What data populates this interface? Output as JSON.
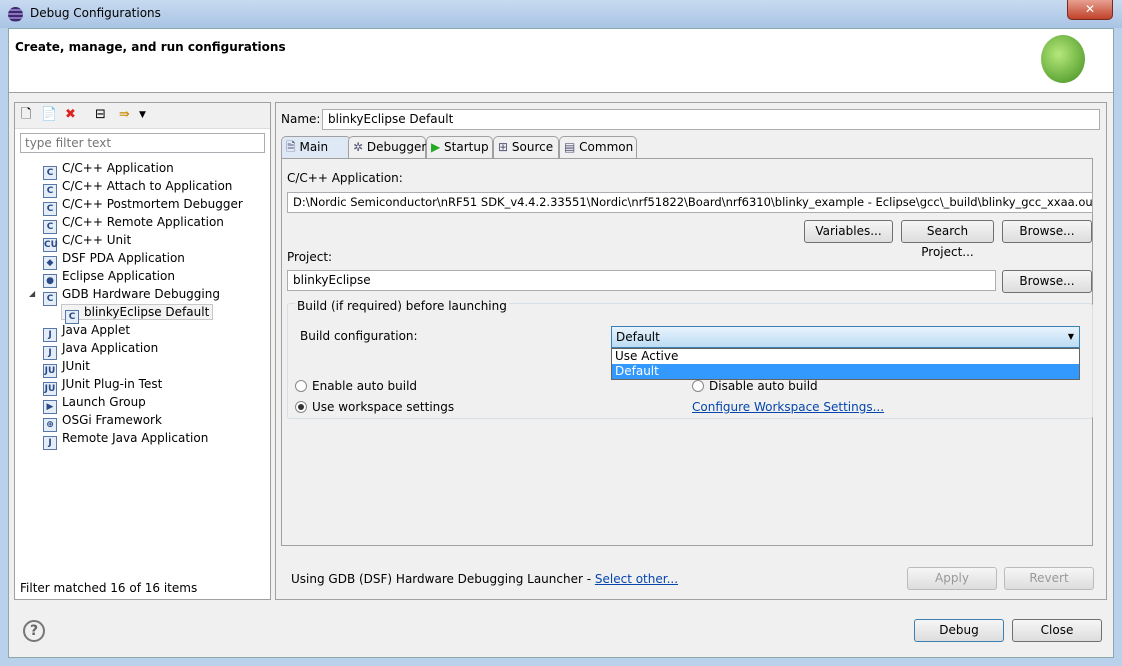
{
  "window": {
    "title": "Debug Configurations",
    "close": "✕"
  },
  "header": {
    "title": "Create, manage, and run configurations"
  },
  "left": {
    "filter_placeholder": "type filter text",
    "items": [
      {
        "label": "C/C++ Application",
        "icon": "C"
      },
      {
        "label": "C/C++ Attach to Application",
        "icon": "C"
      },
      {
        "label": "C/C++ Postmortem Debugger",
        "icon": "C"
      },
      {
        "label": "C/C++ Remote Application",
        "icon": "C"
      },
      {
        "label": "C/C++ Unit",
        "icon": "CU"
      },
      {
        "label": "DSF PDA Application",
        "icon": "◆"
      },
      {
        "label": "Eclipse Application",
        "icon": "●"
      },
      {
        "label": "GDB Hardware Debugging",
        "icon": "C",
        "expanded": true
      },
      {
        "label": "blinkyEclipse Default",
        "icon": "C",
        "selected": true
      },
      {
        "label": "Java Applet",
        "icon": "J"
      },
      {
        "label": "Java Application",
        "icon": "J"
      },
      {
        "label": "JUnit",
        "icon": "JU"
      },
      {
        "label": "JUnit Plug-in Test",
        "icon": "JU"
      },
      {
        "label": "Launch Group",
        "icon": "▶"
      },
      {
        "label": "OSGi Framework",
        "icon": "⊕"
      },
      {
        "label": "Remote Java Application",
        "icon": "J"
      }
    ],
    "status": "Filter matched 16 of 16 items"
  },
  "right": {
    "name_label": "Name:",
    "name_value": "blinkyEclipse Default",
    "tabs": [
      "Main",
      "Debugger",
      "Startup",
      "Source",
      "Common"
    ],
    "app_label": "C/C++ Application:",
    "app_value": "D:\\Nordic Semiconductor\\nRF51 SDK_v4.4.2.33551\\Nordic\\nrf51822\\Board\\nrf6310\\blinky_example - Eclipse\\gcc\\_build\\blinky_gcc_xxaa.out",
    "variables": "Variables...",
    "search_project": "Search Project...",
    "browse": "Browse...",
    "project_label": "Project:",
    "project_value": "blinkyEclipse",
    "group_title": "Build (if required) before launching",
    "build_config_label": "Build configuration:",
    "build_config_value": "Default",
    "build_config_options": [
      "Use Active",
      "Default"
    ],
    "enable_auto": "Enable auto build",
    "disable_auto": "Disable auto build",
    "use_workspace": "Use workspace settings",
    "configure_link": "Configure Workspace Settings...",
    "launcher_text": "Using GDB (DSF) Hardware Debugging Launcher - ",
    "select_other": "Select other...",
    "apply": "Apply",
    "revert": "Revert"
  },
  "footer": {
    "debug": "Debug",
    "close": "Close",
    "help": "?"
  }
}
